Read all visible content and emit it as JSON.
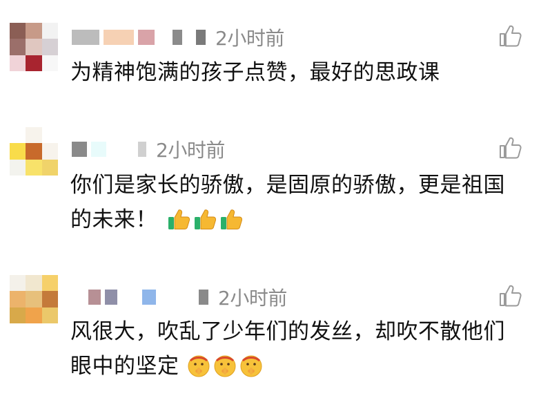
{
  "comments": [
    {
      "time": "2小时前",
      "text": "为精神饱满的孩子点赞，最好的思政课",
      "avatar_colors": [
        "#8b5e55",
        "#c79a88",
        "#f2f2f2",
        "#9b6f6a",
        "#e0c7c0",
        "#d6d0d4",
        "#f0d3d8",
        "#a8242f",
        "#f7f7f7"
      ],
      "name_blur_colors": [
        "#9a9a9a",
        "#f6d1b4",
        "#d9a3a8",
        "#8b8b8b",
        "#7a7a7a"
      ],
      "emojis": []
    },
    {
      "time": "2小时前",
      "text": "你们是家长的骄傲，是固原的骄傲，更是祖国的未来！",
      "avatar_colors": [
        "#ffffff",
        "#f7f3ec",
        "#ffffff",
        "#f9dc4a",
        "#c86a2b",
        "#f7f3ec",
        "#f3f3ee",
        "#f8e26a",
        "#f0d36a"
      ],
      "name_blur_colors": [
        "#8a8a8a",
        "#e8fbfb",
        "#bdbdbd"
      ],
      "emojis": [
        "thumbs-up",
        "thumbs-up",
        "thumbs-up"
      ]
    },
    {
      "time": "2小时前",
      "text": "风很大，吹乱了少年们的发丝，却吹不散他们眼中的坚定",
      "avatar_colors": [
        "#f4f1ea",
        "#f1e7cf",
        "#f6d06a",
        "#ecb36b",
        "#e7c07b",
        "#c47a3a",
        "#d8a94a",
        "#f0a34b",
        "#ebc86a"
      ],
      "name_blur_colors": [
        "#b79095",
        "#8f8fa8",
        "#8fb6ea",
        "#8a8a8a"
      ],
      "emojis": [
        "shush-face",
        "shush-face",
        "shush-face"
      ]
    }
  ],
  "colors": {
    "text": "#111111",
    "time": "#8a8a8a",
    "like_icon": "#9a9a9a"
  }
}
